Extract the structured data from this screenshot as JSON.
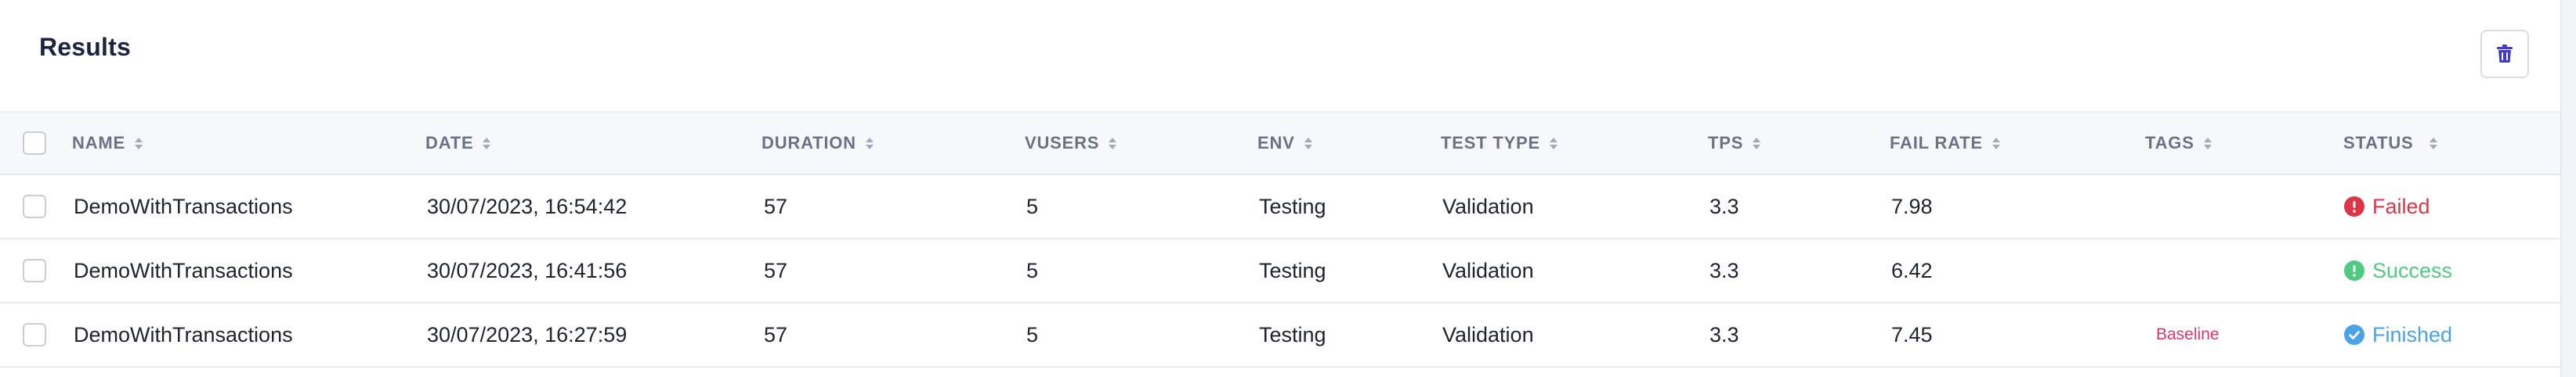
{
  "header": {
    "title": "Results"
  },
  "toolbar": {
    "delete_icon": "trash-icon"
  },
  "table": {
    "columns": [
      {
        "key": "name",
        "label": "NAME"
      },
      {
        "key": "date",
        "label": "DATE"
      },
      {
        "key": "duration",
        "label": "DURATION"
      },
      {
        "key": "vusers",
        "label": "VUSERS"
      },
      {
        "key": "env",
        "label": "ENV"
      },
      {
        "key": "test_type",
        "label": "TEST TYPE"
      },
      {
        "key": "tps",
        "label": "TPS"
      },
      {
        "key": "fail_rate",
        "label": "FAIL RATE"
      },
      {
        "key": "tags",
        "label": "TAGS"
      },
      {
        "key": "status",
        "label": "STATUS"
      }
    ],
    "rows": [
      {
        "name": "DemoWithTransactions",
        "date": "30/07/2023, 16:54:42",
        "duration": "57",
        "vusers": "5",
        "env": "Testing",
        "test_type": "Validation",
        "tps": "3.3",
        "fail_rate": "7.98",
        "tags": "",
        "status": "Failed",
        "status_color": "#dc3545",
        "status_icon": "exclamation-circle-icon"
      },
      {
        "name": "DemoWithTransactions",
        "date": "30/07/2023, 16:41:56",
        "duration": "57",
        "vusers": "5",
        "env": "Testing",
        "test_type": "Validation",
        "tps": "3.3",
        "fail_rate": "6.42",
        "tags": "",
        "status": "Success",
        "status_color": "#4fcb80",
        "status_icon": "exclamation-circle-icon"
      },
      {
        "name": "DemoWithTransactions",
        "date": "30/07/2023, 16:27:59",
        "duration": "57",
        "vusers": "5",
        "env": "Testing",
        "test_type": "Validation",
        "tps": "3.3",
        "fail_rate": "7.45",
        "tags": "Baseline",
        "status": "Finished",
        "status_color": "#4aa3e8",
        "status_icon": "check-circle-icon"
      }
    ]
  },
  "colors": {
    "accent": "#4338ca",
    "tag": "#e2336b"
  }
}
